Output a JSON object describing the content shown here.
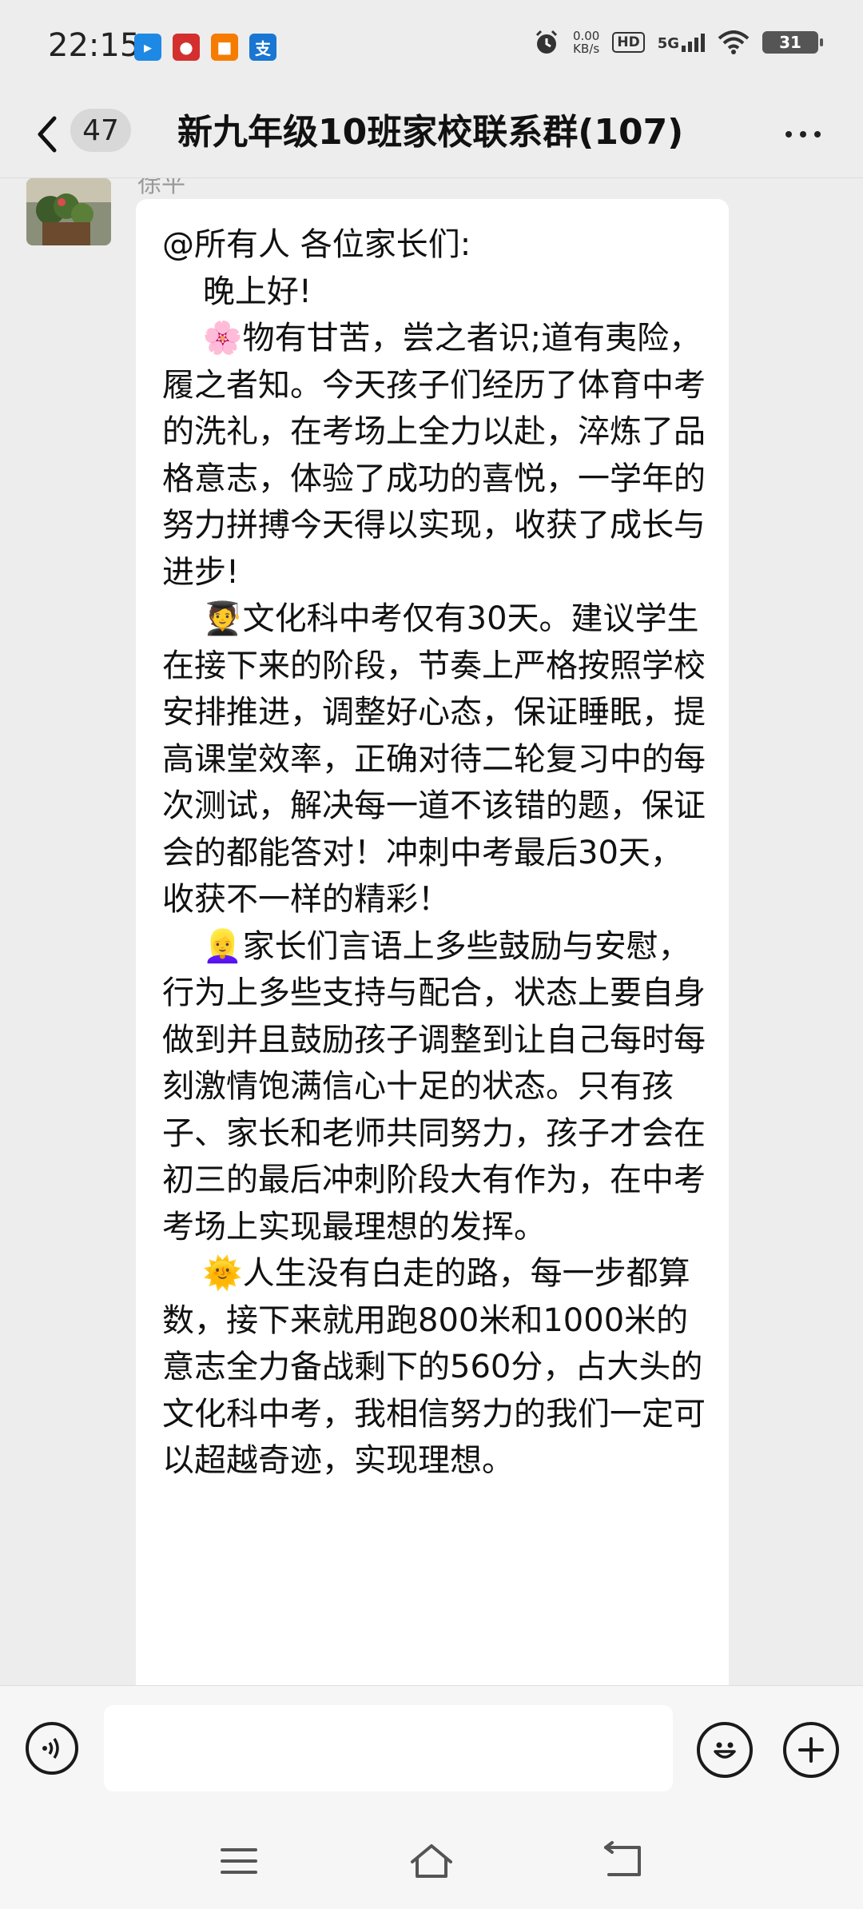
{
  "status_bar": {
    "time": "22:15",
    "net_speed_value": "0.00",
    "net_speed_unit": "KB/s",
    "hd_label": "HD",
    "network": "5G",
    "battery": "31"
  },
  "header": {
    "unread_count": "47",
    "title": "新九年级10班家校联系群(107)"
  },
  "message": {
    "sender_name": "徐平",
    "text": "@所有人 各位家长们:\n    晚上好!\n    🌸物有甘苦，尝之者识;道有夷险，履之者知。今天孩子们经历了体育中考的洗礼，在考场上全力以赴，淬炼了品格意志，体验了成功的喜悦，一学年的努力拼搏今天得以实现，收获了成长与进步!\n    🧑‍🎓文化科中考仅有30天。建议学生在接下来的阶段，节奏上严格按照学校安排推进，调整好心态，保证睡眠，提高课堂效率，正确对待二轮复习中的每次测试，解决每一道不该错的题，保证会的都能答对！冲刺中考最后30天，收获不一样的精彩！\n    👱‍♀️家长们言语上多些鼓励与安慰，行为上多些支持与配合，状态上要自身做到并且鼓励孩子调整到让自己每时每刻激情饱满信心十足的状态。只有孩子、家长和老师共同努力，孩子才会在初三的最后冲刺阶段大有作为，在中考考场上实现最理想的发挥。\n    🌞人生没有白走的路，每一步都算数，接下来就用跑800米和1000米的意志全力备战剩下的560分，占大头的文化科中考，我相信努力的我们一定可以超越奇迹，实现理想。"
  },
  "input_bar": {
    "voice_icon": "voice-icon",
    "emoji_icon": "emoji-icon",
    "plus_icon": "plus-icon"
  },
  "colors": {
    "background": "#ededed",
    "bubble": "#ffffff",
    "text": "#111111"
  }
}
